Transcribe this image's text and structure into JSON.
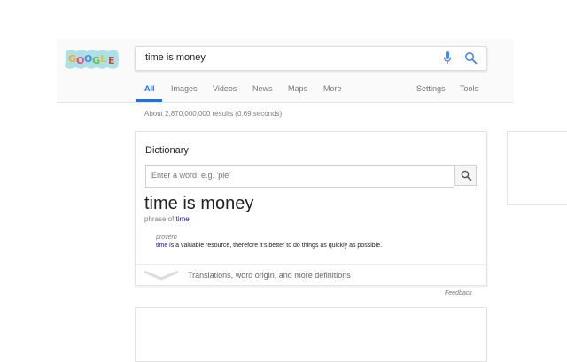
{
  "logo": {
    "text": "GOOGLE",
    "letters": [
      "G",
      "O",
      "O",
      "G",
      "L",
      "E"
    ],
    "colors": [
      "#f2a93b",
      "#e84a7f",
      "#4a90d9",
      "#6cbf4a",
      "#e8c23a",
      "#d64b3c"
    ],
    "background": "#aee0e8"
  },
  "search": {
    "query": "time is money"
  },
  "tabs": [
    {
      "label": "All",
      "active": true
    },
    {
      "label": "Images"
    },
    {
      "label": "Videos"
    },
    {
      "label": "News"
    },
    {
      "label": "Maps"
    },
    {
      "label": "More"
    }
  ],
  "right_tabs": [
    {
      "label": "Settings"
    },
    {
      "label": "Tools"
    }
  ],
  "results_stats": "About 2,870,000,000 results (0.69 seconds)",
  "dictionary": {
    "title": "Dictionary",
    "input_placeholder": "Enter a word, e.g. 'pie'",
    "word": "time is money",
    "phrase_prefix": "phrase of",
    "phrase_link": "time",
    "part_of_speech": "proverb",
    "definition_keyword": "time",
    "definition_rest": " is a valuable resource, therefore it's better to do things as quickly as possible.",
    "more_link": "Translations, word origin, and more definitions"
  },
  "feedback": "Feedback",
  "colors": {
    "accent": "#1a73e8",
    "link": "#1a0dab",
    "mic_blue": "#4285f4",
    "mic_red": "#ea4335"
  },
  "icons": [
    "microphone-icon",
    "search-icon",
    "chevron-down-icon"
  ]
}
